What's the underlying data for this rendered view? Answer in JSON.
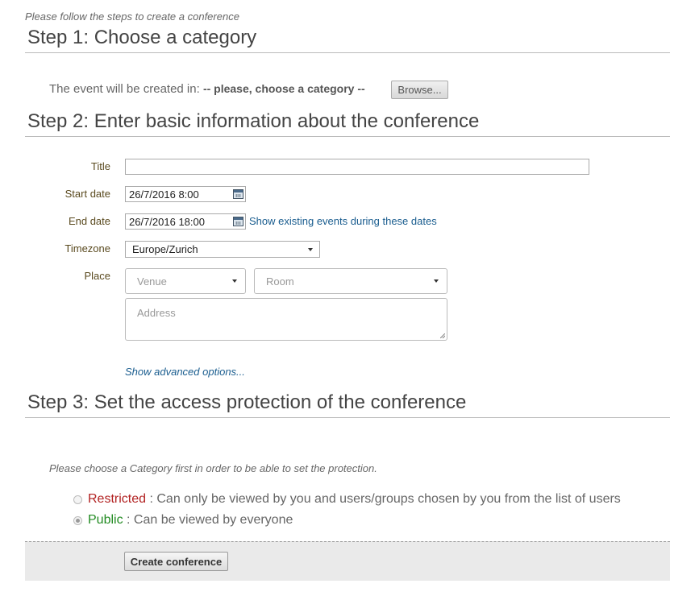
{
  "intro_text": "Please follow the steps to create a conference",
  "step1": {
    "title": "Step 1: Choose a category",
    "created_in_label": "The event will be created in:",
    "category_value": "-- please, choose a category --",
    "browse_label": "Browse..."
  },
  "step2": {
    "title": "Step 2: Enter basic information about the conference",
    "title_label": "Title",
    "title_value": "",
    "start_label": "Start date",
    "start_value": "26/7/2016 8:00",
    "end_label": "End date",
    "end_value": "26/7/2016 18:00",
    "show_events_link": "Show existing events during these dates",
    "timezone_label": "Timezone",
    "timezone_value": "Europe/Zurich",
    "place_label": "Place",
    "venue_placeholder": "Venue",
    "room_placeholder": "Room",
    "address_placeholder": "Address",
    "advanced_link": "Show advanced options..."
  },
  "step3": {
    "title": "Step 3: Set the access protection of the conference",
    "note": "Please choose a Category first in order to be able to set the protection.",
    "restricted_label": "Restricted",
    "restricted_desc": " : Can only be viewed by you and users/groups chosen by you from the list of users",
    "public_label": "Public",
    "public_desc": " : Can be viewed by everyone",
    "selected": "Public"
  },
  "colors": {
    "restricted": "#b22222",
    "public": "#228b22",
    "link": "#1a5d8f"
  },
  "footer": {
    "create_label": "Create conference"
  }
}
